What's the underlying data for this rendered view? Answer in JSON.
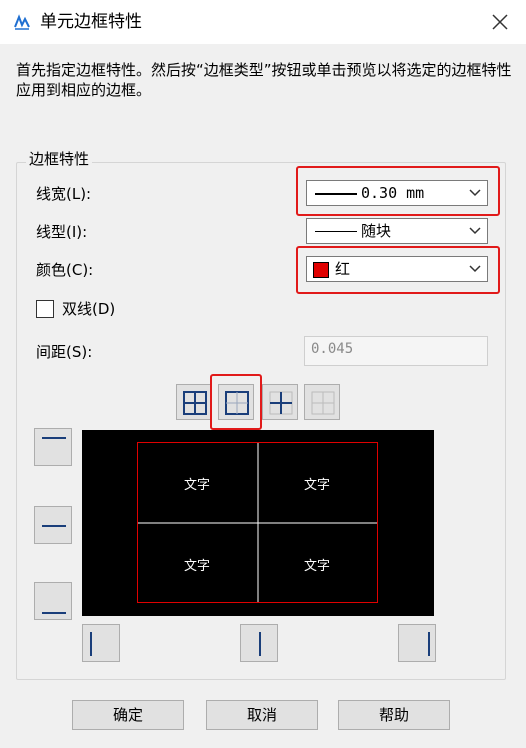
{
  "window": {
    "title": "单元边框特性"
  },
  "description": "首先指定边框特性。然后按“边框类型”按钮或单击预览以将选定的边框特性应用到相应的边框。",
  "group": {
    "title": "边框特性",
    "line_width": {
      "label": "线宽(L):",
      "value": "0.30 mm"
    },
    "line_type": {
      "label": "线型(I):",
      "value": "随块"
    },
    "color": {
      "label": "颜色(C):",
      "value": "红",
      "swatch": "#e00000"
    },
    "double_line": {
      "label": "双线(D)",
      "checked": false
    },
    "spacing": {
      "label": "间距(S):",
      "value": "0.045"
    }
  },
  "preview": {
    "cells": [
      "文字",
      "文字",
      "文字",
      "文字"
    ],
    "border_color": "#e00000"
  },
  "footer": {
    "ok": "确定",
    "cancel": "取消",
    "help": "帮助"
  },
  "highlight_color": "#e11a1a"
}
